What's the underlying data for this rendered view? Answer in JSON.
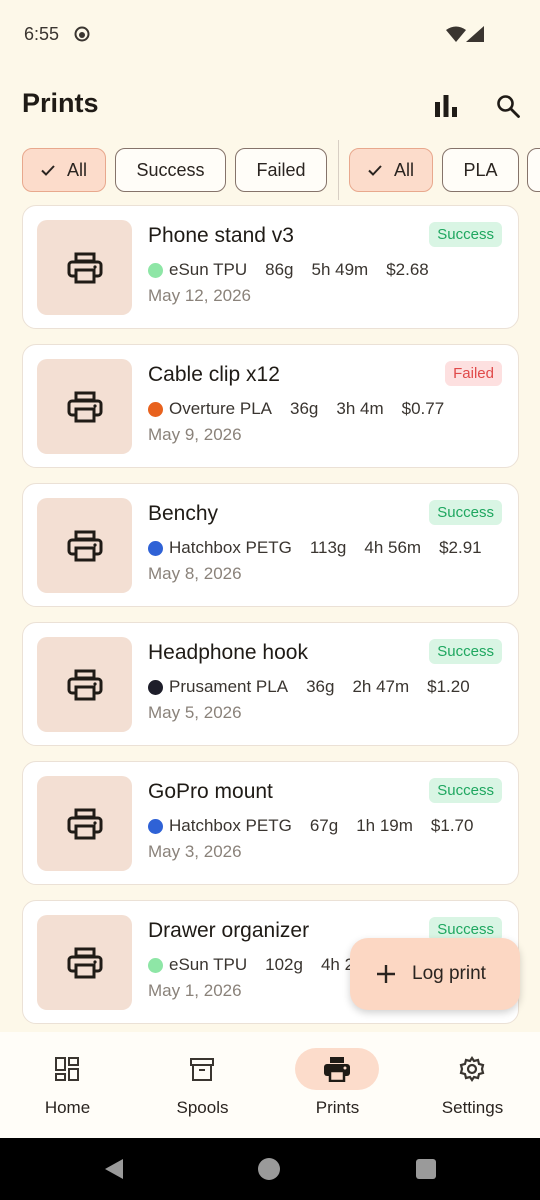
{
  "status_bar": {
    "time": "6:55"
  },
  "header": {
    "title": "Prints"
  },
  "filters": {
    "status": [
      {
        "label": "All",
        "selected": true
      },
      {
        "label": "Success",
        "selected": false
      },
      {
        "label": "Failed",
        "selected": false
      }
    ],
    "material": [
      {
        "label": "All",
        "selected": true
      },
      {
        "label": "PLA",
        "selected": false
      }
    ]
  },
  "prints": [
    {
      "title": "Phone stand v3",
      "status": "Success",
      "filament": "eSun TPU",
      "filament_color": "#8ee6a6",
      "weight": "86g",
      "duration": "5h 49m",
      "cost": "$2.68",
      "date": "May 12, 2026"
    },
    {
      "title": "Cable clip x12",
      "status": "Failed",
      "filament": "Overture PLA",
      "filament_color": "#e8621e",
      "weight": "36g",
      "duration": "3h 4m",
      "cost": "$0.77",
      "date": "May 9, 2026"
    },
    {
      "title": "Benchy",
      "status": "Success",
      "filament": "Hatchbox PETG",
      "filament_color": "#2f62d6",
      "weight": "113g",
      "duration": "4h 56m",
      "cost": "$2.91",
      "date": "May 8, 2026"
    },
    {
      "title": "Headphone hook",
      "status": "Success",
      "filament": "Prusament PLA",
      "filament_color": "#1e1e2a",
      "weight": "36g",
      "duration": "2h 47m",
      "cost": "$1.20",
      "date": "May 5, 2026"
    },
    {
      "title": "GoPro mount",
      "status": "Success",
      "filament": "Hatchbox PETG",
      "filament_color": "#2f62d6",
      "weight": "67g",
      "duration": "1h 19m",
      "cost": "$1.70",
      "date": "May 3, 2026"
    },
    {
      "title": "Drawer organizer",
      "status": "Success",
      "filament": "eSun TPU",
      "filament_color": "#8ee6a6",
      "weight": "102g",
      "duration": "4h 2",
      "cost": "",
      "date": "May 1, 2026"
    }
  ],
  "fab": {
    "label": "Log print"
  },
  "nav": [
    {
      "label": "Home",
      "icon": "dashboard-icon",
      "active": false
    },
    {
      "label": "Spools",
      "icon": "archive-icon",
      "active": false
    },
    {
      "label": "Prints",
      "icon": "printer-icon",
      "active": true
    },
    {
      "label": "Settings",
      "icon": "gear-icon",
      "active": false
    }
  ],
  "colors": {
    "background": "#fdf8e9",
    "accent": "#fcdccb",
    "success": "#1fa760",
    "failed": "#e04a4a"
  }
}
